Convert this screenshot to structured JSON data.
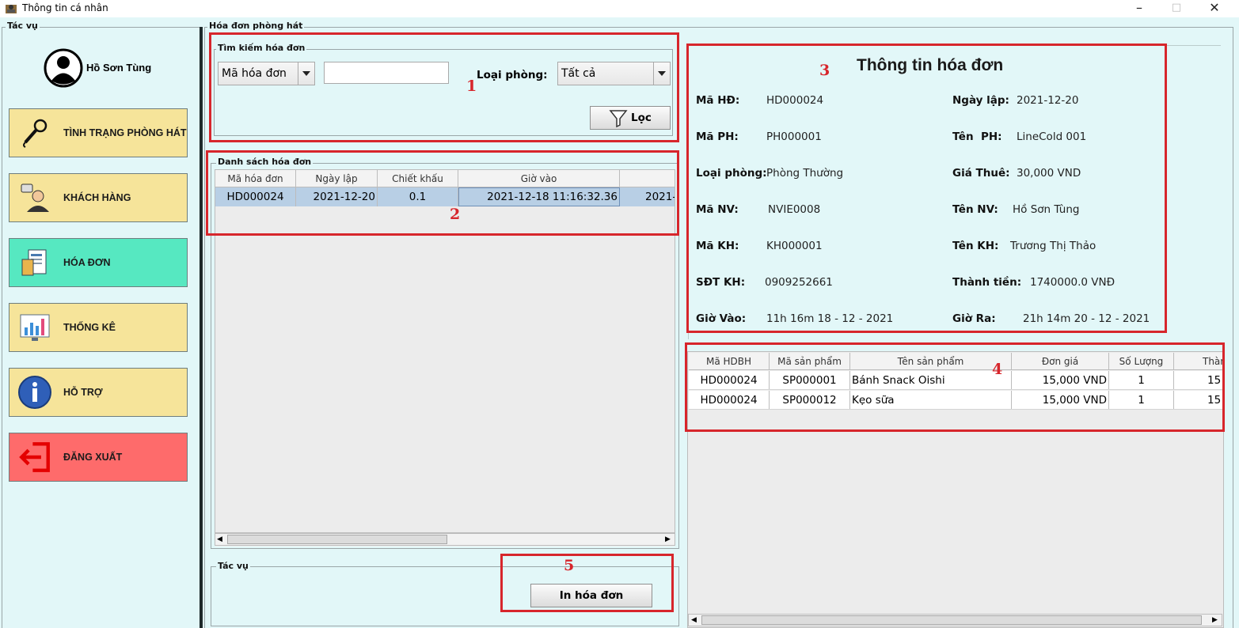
{
  "window": {
    "title": "Thông tin cá nhân"
  },
  "left_panel": {
    "group_label": "Tác vụ",
    "user_name": "Hồ Sơn Tùng",
    "menu": [
      {
        "label": "TÌNH TRẠNG PHÒNG HÁT",
        "icon": "microphone-icon",
        "bg": "#f6e49a"
      },
      {
        "label": "KHÁCH HÀNG",
        "icon": "customer-icon",
        "bg": "#f6e49a"
      },
      {
        "label": "HÓA ĐƠN",
        "icon": "invoice-icon",
        "bg": "#56e8c1"
      },
      {
        "label": "THỐNG KÊ",
        "icon": "chart-icon",
        "bg": "#f6e49a"
      },
      {
        "label": "HỖ TRỢ",
        "icon": "info-icon",
        "bg": "#f6e49a"
      },
      {
        "label": "ĐĂNG XUẤT",
        "icon": "logout-icon",
        "bg": "#fe6b6b"
      }
    ]
  },
  "invoice_panel": {
    "group_label": "Hóa đơn phòng hát",
    "search": {
      "group_label": "Tìm kiếm hóa đơn",
      "field_selected": "Mã hóa đơn",
      "search_value": "",
      "room_type_label": "Loại phòng:",
      "room_type_selected": "Tất cả",
      "filter_button": "Lọc"
    },
    "list": {
      "group_label": "Danh sách hóa đơn",
      "columns": [
        "Mã hóa đơn",
        "Ngày lập",
        "Chiết khấu",
        "Giờ vào",
        ""
      ],
      "rows": [
        [
          "HD000024",
          "2021-12-20",
          "0.1",
          "2021-12-18 11:16:32.36",
          "2021-"
        ]
      ]
    },
    "actions": {
      "group_label": "Tác vụ",
      "print_button": "In hóa đơn"
    }
  },
  "details": {
    "title": "Thông tin hóa đơn",
    "fields": [
      {
        "label": "Mã HĐ:",
        "value": "HD000024"
      },
      {
        "label": "Ngày lập:",
        "value": "2021-12-20"
      },
      {
        "label": "Mã PH:",
        "value": "PH000001"
      },
      {
        "label": "Tên  PH:",
        "value": "LineCold 001"
      },
      {
        "label": "Loại phòng:",
        "value": "Phòng Thường"
      },
      {
        "label": "Giá Thuê:",
        "value": "30,000 VND"
      },
      {
        "label": "Mã NV:",
        "value": "NVIE0008"
      },
      {
        "label": "Tên NV:",
        "value": "Hồ Sơn Tùng"
      },
      {
        "label": "Mã KH:",
        "value": "KH000001"
      },
      {
        "label": "Tên KH:",
        "value": "Trương Thị Thảo"
      },
      {
        "label": "SĐT KH:",
        "value": "0909252661"
      },
      {
        "label": "Thành tiền:",
        "value": "1740000.0 VNĐ"
      },
      {
        "label": "Giờ Vào:",
        "value": "11h 16m 18 - 12 - 2021"
      },
      {
        "label": "Giờ Ra:",
        "value": "21h 14m 20 - 12 - 2021"
      }
    ]
  },
  "products": {
    "columns": [
      "Mã HDBH",
      "Mã sản phẩm",
      "Tên sản phẩm",
      "Đơn giá",
      "Số Lượng",
      "Thàn"
    ],
    "rows": [
      [
        "HD000024",
        "SP000001",
        "Bánh Snack Oishi",
        "15,000 VND",
        "1",
        "15"
      ],
      [
        "HD000024",
        "SP000012",
        "Kẹo sữa",
        "15,000 VND",
        "1",
        "15"
      ]
    ]
  },
  "annotations": [
    "1",
    "2",
    "3",
    "4",
    "5"
  ],
  "colors": {
    "background": "#e2f7f8",
    "highlight_box": "#d7262c",
    "selected_row": "#b8cfe5"
  }
}
